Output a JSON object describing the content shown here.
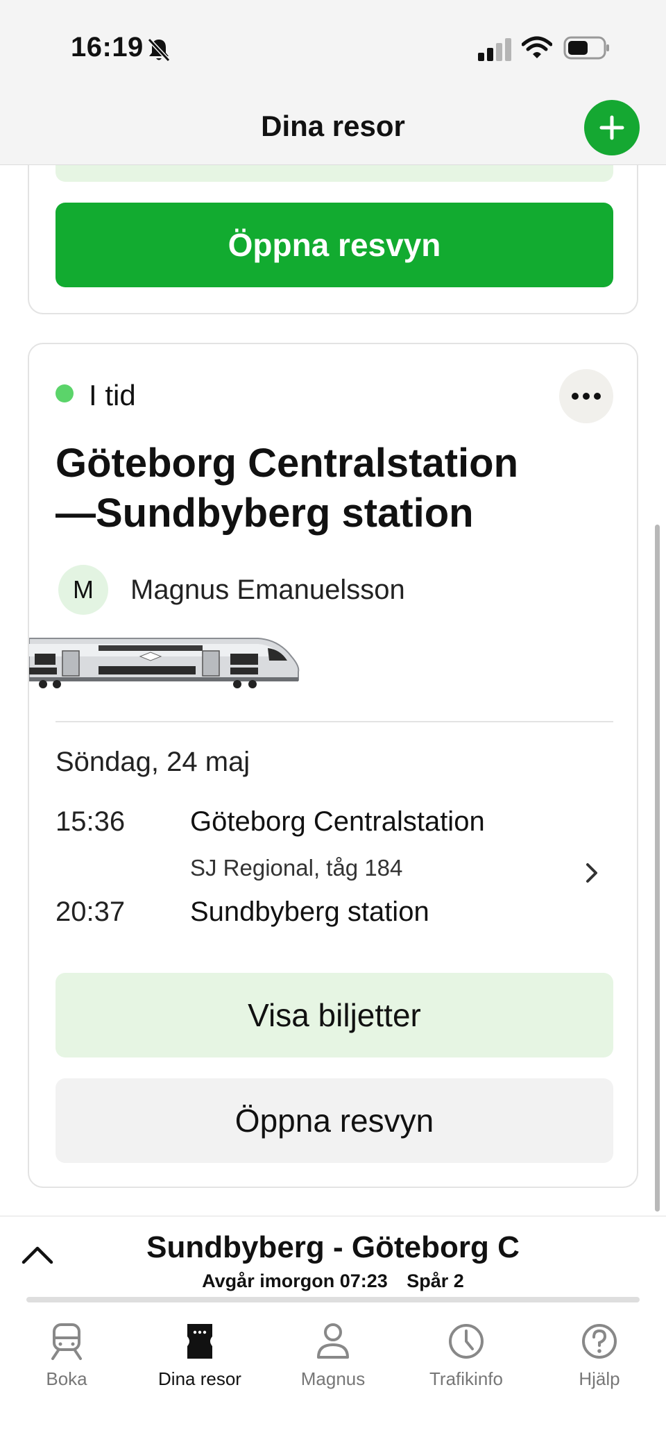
{
  "status_bar": {
    "time": "16:19",
    "icons": [
      "bell-slash-icon",
      "signal-icon",
      "wifi-icon",
      "battery-icon"
    ]
  },
  "header": {
    "title": "Dina resor",
    "add_icon": "plus-icon"
  },
  "colors": {
    "primary_green": "#12ab30",
    "light_green": "#e6f5e3",
    "status_green": "#5bd46a",
    "secondary_gray": "#f2f2f2"
  },
  "previous_card": {
    "open_button": "Öppna resvyn"
  },
  "trip_card": {
    "status": "I tid",
    "route_line1": "Göteborg Centralstation",
    "route_line2": "—Sundbyberg station",
    "passenger_initial": "M",
    "passenger_name": "Magnus Emanuelsson",
    "date": "Söndag, 24 maj",
    "departure_time": "15:36",
    "departure_station": "Göteborg Centralstation",
    "train_info": "SJ Regional, tåg 184",
    "arrival_time": "20:37",
    "arrival_station": "Sundbyberg station",
    "tickets_button": "Visa biljetter",
    "open_button": "Öppna resvyn"
  },
  "upcoming": {
    "route": "Sundbyberg - Göteborg C",
    "departs": "Avgår imorgon 07:23",
    "track": "Spår  2"
  },
  "tabs": [
    {
      "label": "Boka",
      "icon": "train-icon",
      "active": false
    },
    {
      "label": "Dina resor",
      "icon": "ticket-icon",
      "active": true
    },
    {
      "label": "Magnus",
      "icon": "person-icon",
      "active": false
    },
    {
      "label": "Trafikinfo",
      "icon": "clock-icon",
      "active": false
    },
    {
      "label": "Hjälp",
      "icon": "help-icon",
      "active": false
    }
  ]
}
